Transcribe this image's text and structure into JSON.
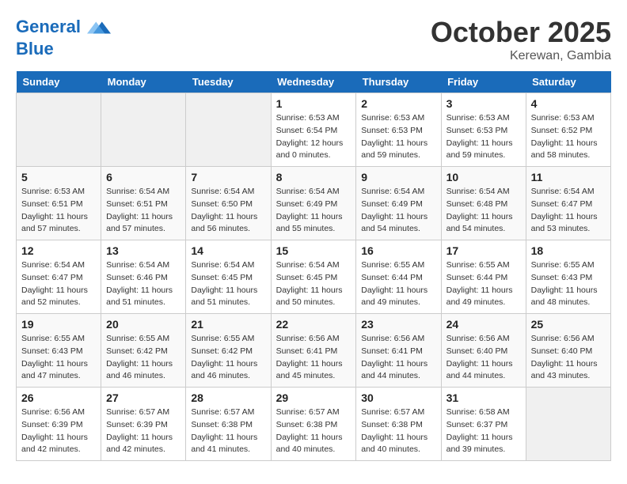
{
  "header": {
    "logo_line1": "General",
    "logo_line2": "Blue",
    "month": "October 2025",
    "location": "Kerewan, Gambia"
  },
  "days_of_week": [
    "Sunday",
    "Monday",
    "Tuesday",
    "Wednesday",
    "Thursday",
    "Friday",
    "Saturday"
  ],
  "weeks": [
    [
      {
        "num": "",
        "info": ""
      },
      {
        "num": "",
        "info": ""
      },
      {
        "num": "",
        "info": ""
      },
      {
        "num": "1",
        "info": "Sunrise: 6:53 AM\nSunset: 6:54 PM\nDaylight: 12 hours\nand 0 minutes."
      },
      {
        "num": "2",
        "info": "Sunrise: 6:53 AM\nSunset: 6:53 PM\nDaylight: 11 hours\nand 59 minutes."
      },
      {
        "num": "3",
        "info": "Sunrise: 6:53 AM\nSunset: 6:53 PM\nDaylight: 11 hours\nand 59 minutes."
      },
      {
        "num": "4",
        "info": "Sunrise: 6:53 AM\nSunset: 6:52 PM\nDaylight: 11 hours\nand 58 minutes."
      }
    ],
    [
      {
        "num": "5",
        "info": "Sunrise: 6:53 AM\nSunset: 6:51 PM\nDaylight: 11 hours\nand 57 minutes."
      },
      {
        "num": "6",
        "info": "Sunrise: 6:54 AM\nSunset: 6:51 PM\nDaylight: 11 hours\nand 57 minutes."
      },
      {
        "num": "7",
        "info": "Sunrise: 6:54 AM\nSunset: 6:50 PM\nDaylight: 11 hours\nand 56 minutes."
      },
      {
        "num": "8",
        "info": "Sunrise: 6:54 AM\nSunset: 6:49 PM\nDaylight: 11 hours\nand 55 minutes."
      },
      {
        "num": "9",
        "info": "Sunrise: 6:54 AM\nSunset: 6:49 PM\nDaylight: 11 hours\nand 54 minutes."
      },
      {
        "num": "10",
        "info": "Sunrise: 6:54 AM\nSunset: 6:48 PM\nDaylight: 11 hours\nand 54 minutes."
      },
      {
        "num": "11",
        "info": "Sunrise: 6:54 AM\nSunset: 6:47 PM\nDaylight: 11 hours\nand 53 minutes."
      }
    ],
    [
      {
        "num": "12",
        "info": "Sunrise: 6:54 AM\nSunset: 6:47 PM\nDaylight: 11 hours\nand 52 minutes."
      },
      {
        "num": "13",
        "info": "Sunrise: 6:54 AM\nSunset: 6:46 PM\nDaylight: 11 hours\nand 51 minutes."
      },
      {
        "num": "14",
        "info": "Sunrise: 6:54 AM\nSunset: 6:45 PM\nDaylight: 11 hours\nand 51 minutes."
      },
      {
        "num": "15",
        "info": "Sunrise: 6:54 AM\nSunset: 6:45 PM\nDaylight: 11 hours\nand 50 minutes."
      },
      {
        "num": "16",
        "info": "Sunrise: 6:55 AM\nSunset: 6:44 PM\nDaylight: 11 hours\nand 49 minutes."
      },
      {
        "num": "17",
        "info": "Sunrise: 6:55 AM\nSunset: 6:44 PM\nDaylight: 11 hours\nand 49 minutes."
      },
      {
        "num": "18",
        "info": "Sunrise: 6:55 AM\nSunset: 6:43 PM\nDaylight: 11 hours\nand 48 minutes."
      }
    ],
    [
      {
        "num": "19",
        "info": "Sunrise: 6:55 AM\nSunset: 6:43 PM\nDaylight: 11 hours\nand 47 minutes."
      },
      {
        "num": "20",
        "info": "Sunrise: 6:55 AM\nSunset: 6:42 PM\nDaylight: 11 hours\nand 46 minutes."
      },
      {
        "num": "21",
        "info": "Sunrise: 6:55 AM\nSunset: 6:42 PM\nDaylight: 11 hours\nand 46 minutes."
      },
      {
        "num": "22",
        "info": "Sunrise: 6:56 AM\nSunset: 6:41 PM\nDaylight: 11 hours\nand 45 minutes."
      },
      {
        "num": "23",
        "info": "Sunrise: 6:56 AM\nSunset: 6:41 PM\nDaylight: 11 hours\nand 44 minutes."
      },
      {
        "num": "24",
        "info": "Sunrise: 6:56 AM\nSunset: 6:40 PM\nDaylight: 11 hours\nand 44 minutes."
      },
      {
        "num": "25",
        "info": "Sunrise: 6:56 AM\nSunset: 6:40 PM\nDaylight: 11 hours\nand 43 minutes."
      }
    ],
    [
      {
        "num": "26",
        "info": "Sunrise: 6:56 AM\nSunset: 6:39 PM\nDaylight: 11 hours\nand 42 minutes."
      },
      {
        "num": "27",
        "info": "Sunrise: 6:57 AM\nSunset: 6:39 PM\nDaylight: 11 hours\nand 42 minutes."
      },
      {
        "num": "28",
        "info": "Sunrise: 6:57 AM\nSunset: 6:38 PM\nDaylight: 11 hours\nand 41 minutes."
      },
      {
        "num": "29",
        "info": "Sunrise: 6:57 AM\nSunset: 6:38 PM\nDaylight: 11 hours\nand 40 minutes."
      },
      {
        "num": "30",
        "info": "Sunrise: 6:57 AM\nSunset: 6:38 PM\nDaylight: 11 hours\nand 40 minutes."
      },
      {
        "num": "31",
        "info": "Sunrise: 6:58 AM\nSunset: 6:37 PM\nDaylight: 11 hours\nand 39 minutes."
      },
      {
        "num": "",
        "info": ""
      }
    ]
  ]
}
